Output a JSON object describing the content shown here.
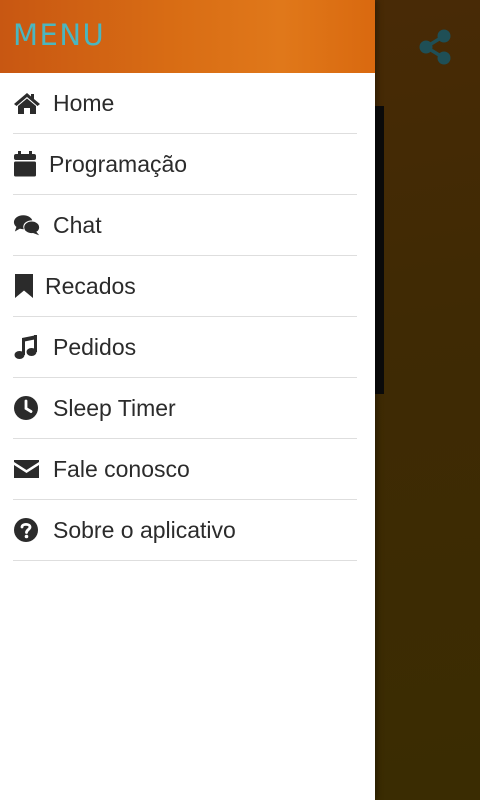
{
  "drawer": {
    "title": "MENU",
    "title_color": "#4bb6bf",
    "header_color": "#d86c14",
    "items": [
      {
        "label": "Home",
        "icon": "home-icon"
      },
      {
        "label": "Programação",
        "icon": "calendar-icon"
      },
      {
        "label": "Chat",
        "icon": "chat-bubbles-icon"
      },
      {
        "label": "Recados",
        "icon": "bookmark-icon"
      },
      {
        "label": "Pedidos",
        "icon": "music-note-icon"
      },
      {
        "label": "Sleep Timer",
        "icon": "clock-icon"
      },
      {
        "label": "Fale conosco",
        "icon": "envelope-icon"
      },
      {
        "label": "Sobre o aplicativo",
        "icon": "question-circle-icon"
      }
    ]
  },
  "background": {
    "share_icon": "share-icon",
    "share_icon_color": "#1f4f56"
  }
}
